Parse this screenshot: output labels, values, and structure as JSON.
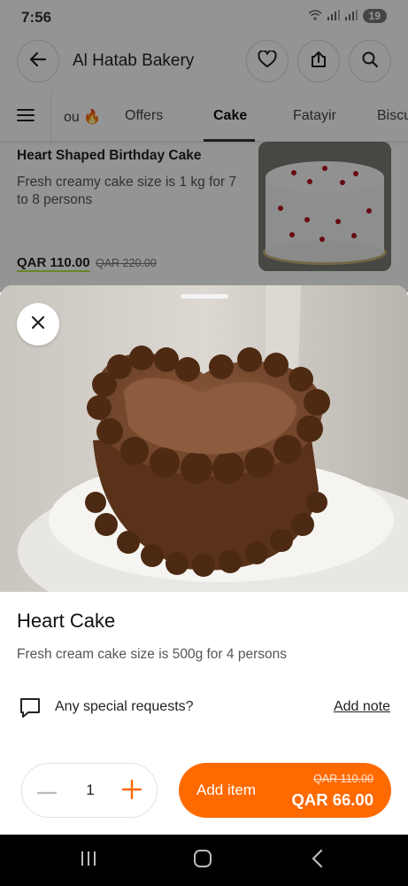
{
  "status_bar": {
    "time": "7:56",
    "battery": "19",
    "icons": [
      "wifi-icon",
      "signal-icon",
      "signal-icon",
      "battery-icon"
    ]
  },
  "header": {
    "store_name": "Al Hatab Bakery",
    "icons": [
      "back-arrow-icon",
      "heart-icon",
      "share-icon",
      "search-icon"
    ]
  },
  "tabs": {
    "items": [
      {
        "label": "ou 🔥"
      },
      {
        "label": "Offers"
      },
      {
        "label": "Cake"
      },
      {
        "label": "Fatayir"
      },
      {
        "label": "Biscu"
      }
    ],
    "active": "Cake"
  },
  "background_product": {
    "title": "Heart Shaped Birthday Cake",
    "description": "Fresh creamy cake size is 1 kg for 7 to 8 persons",
    "price": "QAR 110.00",
    "old_price": "QAR 220.00"
  },
  "item": {
    "title": "Heart Cake",
    "description": "Fresh cream cake size is 500g for 4 persons"
  },
  "special_requests": {
    "label": "Any special requests?",
    "action": "Add note"
  },
  "quantity": {
    "value": "1"
  },
  "add_button": {
    "label": "Add item",
    "old_price": "QAR 110.00",
    "price": "QAR 66.00"
  },
  "colors": {
    "accent": "#ff6a00",
    "price_underline": "#b8e34a",
    "nav_bar": "#000000"
  }
}
